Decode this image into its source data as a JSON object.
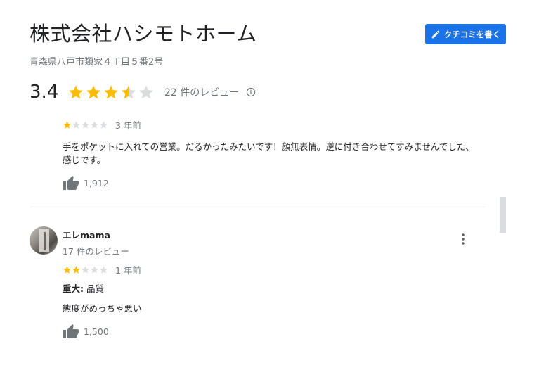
{
  "business": {
    "name": "株式会社ハシモトホーム",
    "address": "青森県八戸市類家４丁目５番2号",
    "write_review_label": "クチコミを書く"
  },
  "summary": {
    "rating": "3.4",
    "stars": 3.5,
    "review_count": "22 件のレビュー"
  },
  "reviews": [
    {
      "stars": 1,
      "time": "3 年前",
      "text": "手をポケットに入れての営業。だるかったみたいです！顔無表情。逆に付き合わせてすみませんでした、感じです。",
      "likes": "1,912"
    },
    {
      "author": "エレmama",
      "author_reviews": "17 件のレビュー",
      "stars": 2,
      "time": "1 年前",
      "attribute_label": "重大:",
      "attribute_value": "品質",
      "text": "態度がめっちゃ悪い",
      "likes": "1,500"
    }
  ],
  "colors": {
    "star_filled": "#fbbc04",
    "star_empty": "#dadce0",
    "accent": "#1a73e8",
    "secondary_text": "#70757a"
  }
}
